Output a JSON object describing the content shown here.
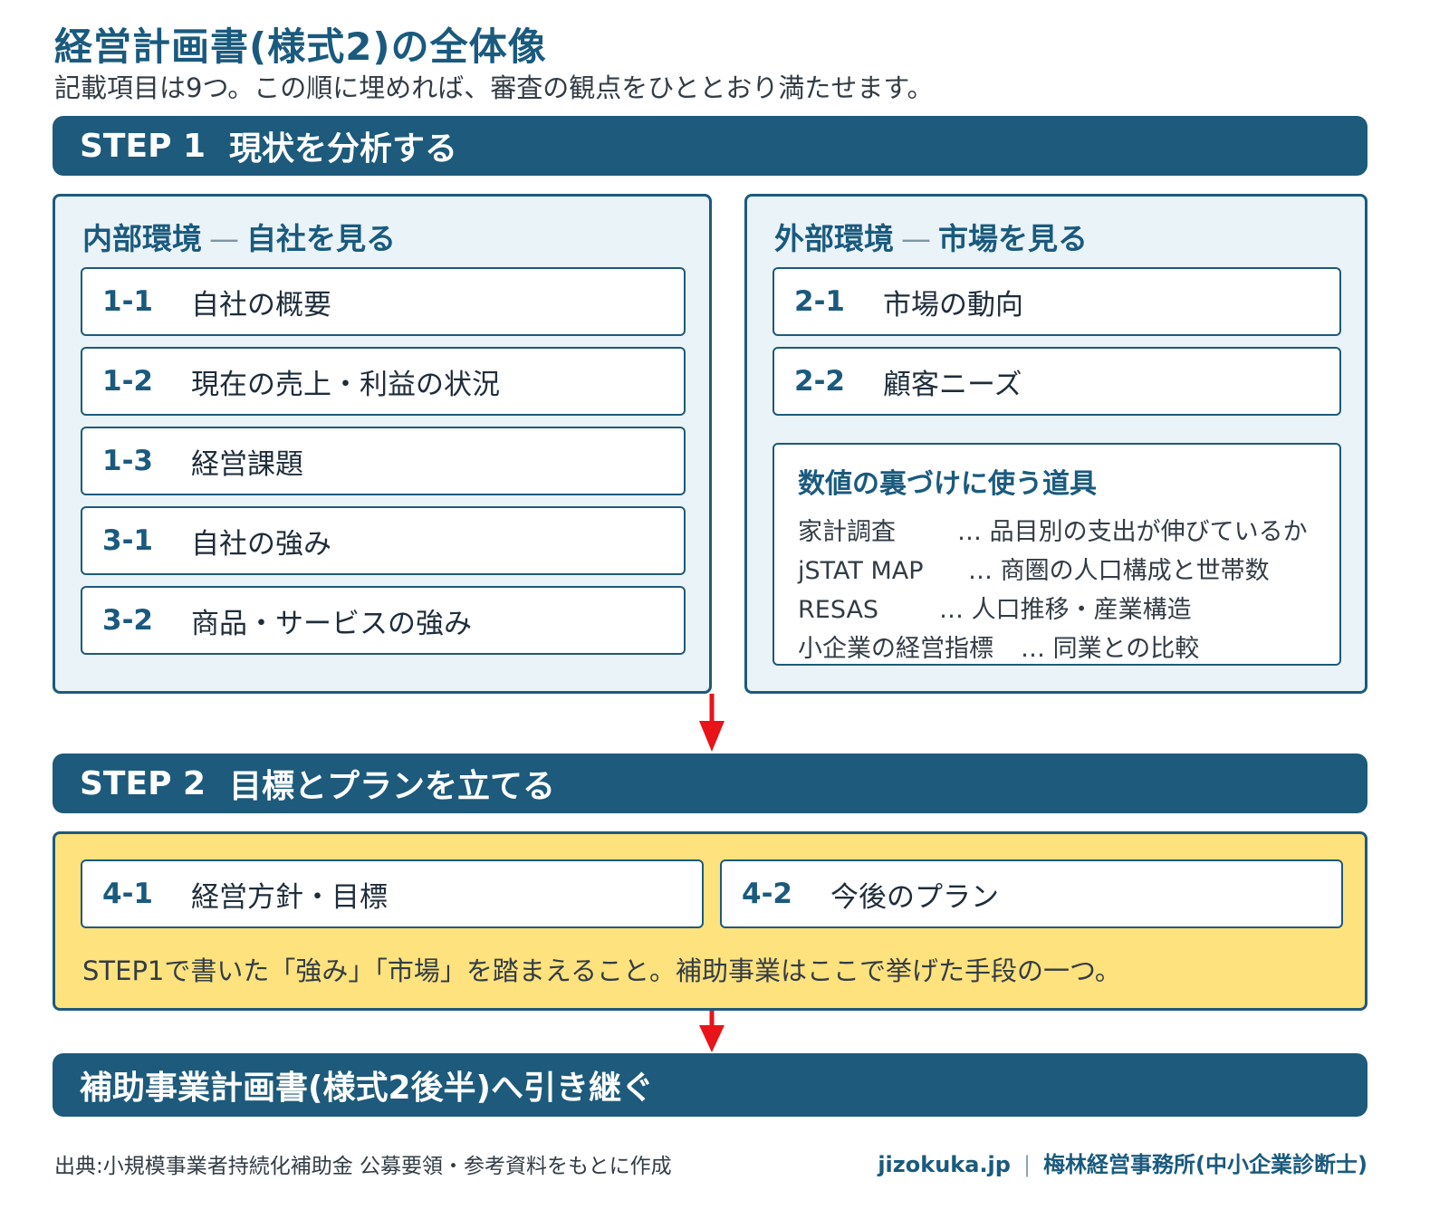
{
  "header": {
    "title": "経営計画書(様式2)の全体像",
    "subtitle": "記載項目は9つ。この順に埋めれば、審査の観点をひととおり満たせます。"
  },
  "step1": {
    "step": "STEP 1",
    "label": "現状を分析する",
    "internal": {
      "heading": "内部環境",
      "dash": "—",
      "subheading": "自社を見る",
      "items": [
        {
          "num": "1-1",
          "label": "自社の概要"
        },
        {
          "num": "1-2",
          "label": "現在の売上・利益の状況"
        },
        {
          "num": "1-3",
          "label": "経営課題"
        },
        {
          "num": "3-1",
          "label": "自社の強み"
        },
        {
          "num": "3-2",
          "label": "商品・サービスの強み"
        }
      ]
    },
    "external": {
      "heading": "外部環境",
      "dash": "—",
      "subheading": "市場を見る",
      "items": [
        {
          "num": "2-1",
          "label": "市場の動向"
        },
        {
          "num": "2-2",
          "label": "顧客ニーズ"
        }
      ],
      "tools": {
        "heading": "数値の裏づけに使う道具",
        "rows": [
          {
            "name": "家計調査",
            "desc": "… 品目別の支出が伸びているか"
          },
          {
            "name": "jSTAT MAP",
            "desc": "… 商圏の人口構成と世帯数"
          },
          {
            "name": "RESAS",
            "desc": "… 人口推移・産業構造"
          },
          {
            "name": "小企業の経営指標",
            "desc": "… 同業との比較"
          }
        ]
      }
    }
  },
  "step2": {
    "step": "STEP 2",
    "label": "目標とプランを立てる",
    "items": [
      {
        "num": "4-1",
        "label": "経営方針・目標"
      },
      {
        "num": "4-2",
        "label": "今後のプラン"
      }
    ],
    "note": "STEP1で書いた「強み」「市場」を踏まえること。補助事業はここで挙げた手段の一つ。"
  },
  "final": {
    "label": "補助事業計画書(様式2後半)へ引き継ぐ"
  },
  "footer": {
    "source": "出典:小規模事業者持続化補助金 公募要領・参考資料をもとに作成",
    "site": "jizokuka.jp",
    "separator": "|",
    "org": "梅林経営事務所(中小企業診断士)"
  },
  "colors": {
    "band": "#1d5a7b",
    "panel_bg": "#eaf3f8",
    "step2_bg": "#fde27e",
    "arrow": "#e8141a",
    "accent_text": "#1a5a7e"
  }
}
